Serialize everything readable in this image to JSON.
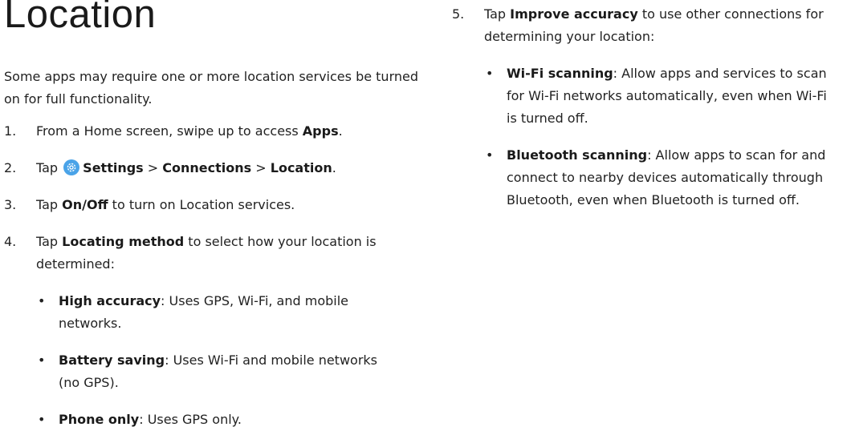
{
  "title": "Location",
  "intro": "Some apps may require one or more location services be turned on for full functionality.",
  "steps": [
    {
      "num": "1.",
      "pre": "From a Home screen, swipe up to access ",
      "bold": "Apps",
      "post": "."
    },
    {
      "num": "2.",
      "pre": "Tap ",
      "icon": "settings-gear-icon",
      "b1": "Settings",
      "sep1": " > ",
      "b2": "Connections",
      "sep2": " > ",
      "b3": "Location",
      "post": "."
    },
    {
      "num": "3.",
      "pre": "Tap ",
      "bold": "On/Off",
      "post": " to turn on Location services."
    },
    {
      "num": "4.",
      "pre": "Tap ",
      "bold": "Locating method",
      "post": " to select how your location is determined:",
      "subs": [
        {
          "bold": "High accuracy",
          "text": ": Uses GPS, Wi-Fi, and mobile networks."
        },
        {
          "bold": "Battery saving",
          "text": ": Uses Wi-Fi and mobile networks (no GPS)."
        },
        {
          "bold": "Phone only",
          "text": ": Uses GPS only."
        }
      ]
    },
    {
      "num": "5.",
      "pre": "Tap ",
      "bold": "Improve accuracy",
      "post": " to use other connections for determining your location:",
      "subs": [
        {
          "bold": "Wi-Fi scanning",
          "text": ": Allow apps and services to scan for Wi-Fi networks automatically, even when Wi-Fi is turned off."
        },
        {
          "bold": "Bluetooth scanning",
          "text": ": Allow apps to scan for and connect to nearby devices automatically through Bluetooth, even when Bluetooth is turned off."
        }
      ]
    }
  ],
  "bullet_char": "•",
  "colors": {
    "icon_bg": "#4aa3e8",
    "text": "#222222"
  }
}
